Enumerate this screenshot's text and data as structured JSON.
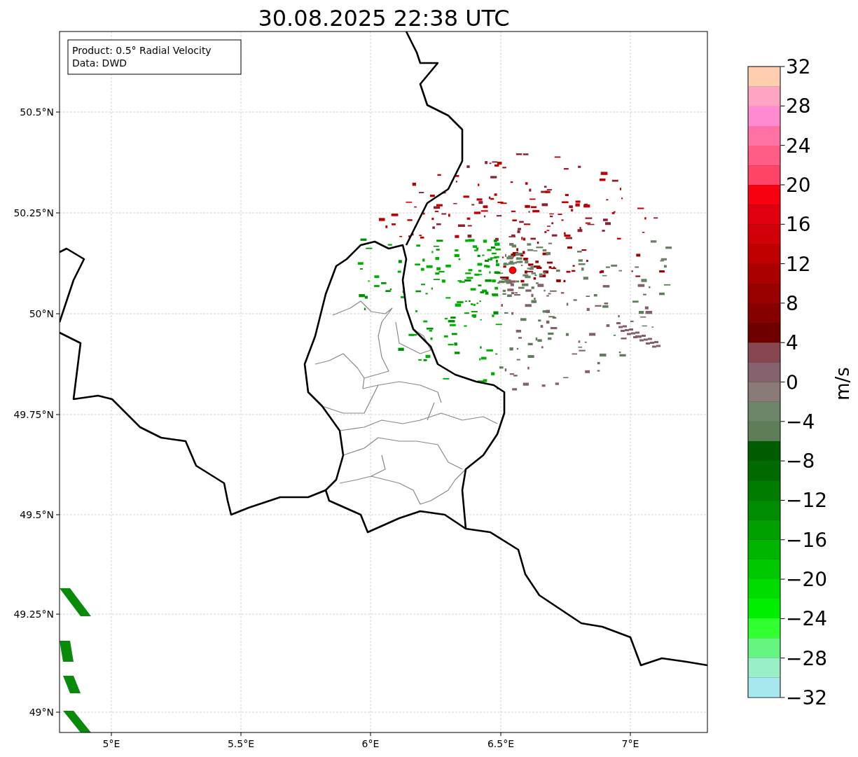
{
  "title": "30.08.2025 22:38 UTC",
  "info_box": [
    "Product: 0.5° Radial Velocity",
    "Data: DWD"
  ],
  "map": {
    "yticks": [
      "50.5°N",
      "50.25°N",
      "50°N",
      "49.75°N",
      "49.5°N",
      "49.25°N",
      "49°N"
    ],
    "xticks": [
      "5°E",
      "5.5°E",
      "6°E",
      "6.5°E",
      "7°E"
    ]
  },
  "colorbar": {
    "label": "m/s",
    "ticks": [
      "32",
      "28",
      "24",
      "20",
      "16",
      "12",
      "8",
      "4",
      "0",
      "−4",
      "−8",
      "−12",
      "−16",
      "−20",
      "−24",
      "−28",
      "−32"
    ]
  }
}
